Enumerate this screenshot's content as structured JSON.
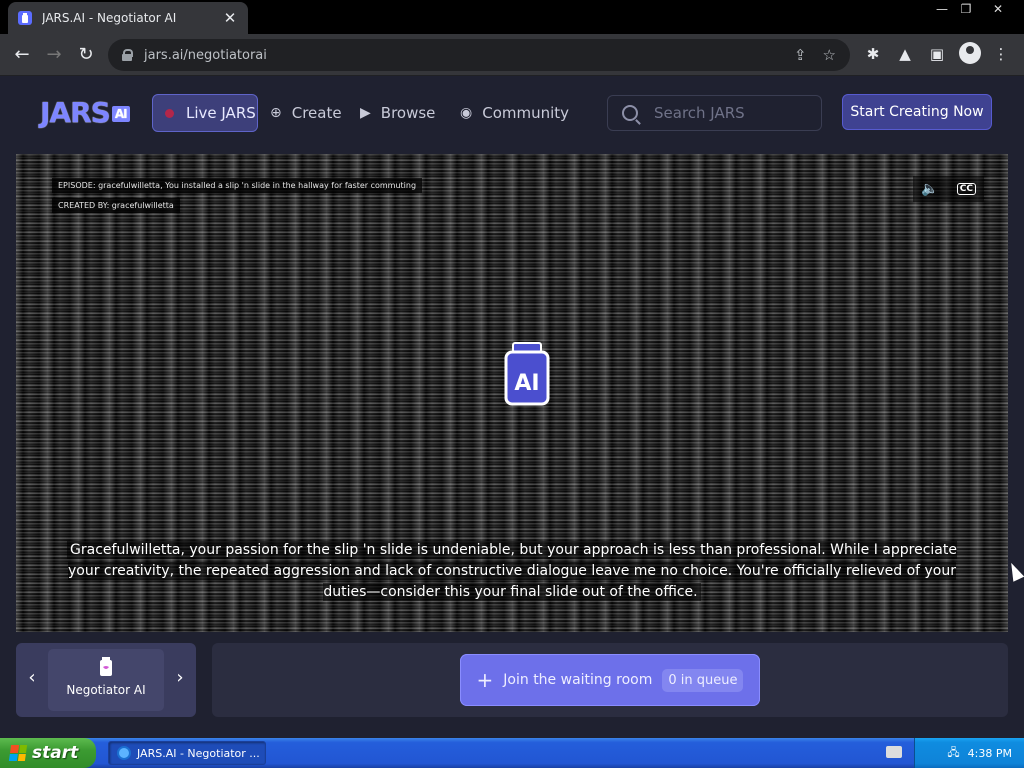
{
  "browser": {
    "tab_title": "JARS.AI - Negotiator AI",
    "tab_close": "✕",
    "url": "jars.ai/negotiatorai",
    "window_controls": [
      "—",
      "❐",
      "✕"
    ]
  },
  "site": {
    "logo_text": "JARS",
    "logo_badge": "AI",
    "nav": {
      "live": "Live JARS",
      "create": "Create",
      "browse": "Browse",
      "community": "Community"
    },
    "search_placeholder": "Search JARS",
    "cta_label": "Start Creating Now"
  },
  "stage": {
    "episode_label": "EPISODE: gracefulwilletta, You installed a slip 'n slide in the hallway for faster commuting",
    "creator_label": "CREATED BY:  gracefulwilletta",
    "cc_label": "CC",
    "subtitle": "Gracefulwilletta, your passion for the slip 'n slide is undeniable, but your approach is less than professional. While I appreciate your creativity, the repeated aggression and lack of constructive dialogue leave me no choice. You're officially relieved of your duties—consider this your final slide out of the office."
  },
  "channel": {
    "name": "Negotiator AI",
    "prev": "‹",
    "next": "›"
  },
  "waiting": {
    "join_label": "Join the waiting room",
    "queue_label": "0 in queue"
  },
  "taskbar": {
    "start_label": "start",
    "task_item": "JARS.AI - Negotiator ...",
    "clock": "4:38 PM"
  },
  "colors": {
    "accent": "#6d70ea",
    "live_dot": "#b3264a",
    "header_bg": "#1f2130"
  }
}
